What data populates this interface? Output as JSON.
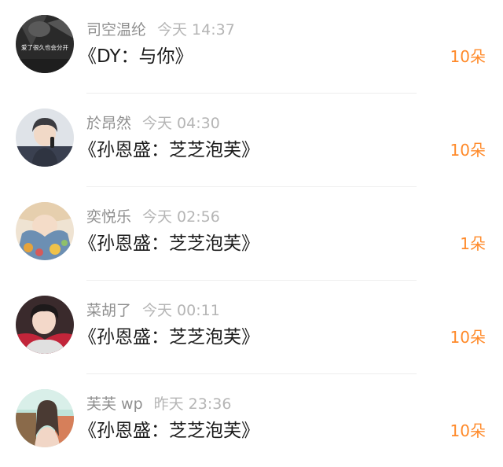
{
  "colors": {
    "username": "#8f8f8f",
    "time": "#b5b5b5",
    "song": "#1c1c1c",
    "accent": "#ff8a2a",
    "divider": "#eeeeee"
  },
  "items": [
    {
      "username": "司空温纶",
      "time": "今天 14:37",
      "song": "《DY：与你》",
      "count": "10朵",
      "avatar": {
        "icon": "avatar-dark-photo-icon",
        "caption": "爱了很久也会分开"
      }
    },
    {
      "username": "於昂然",
      "time": "今天 04:30",
      "song": "《孙恩盛：芝芝泡芙》",
      "count": "10朵",
      "avatar": {
        "icon": "avatar-portrait-icon"
      }
    },
    {
      "username": "奕悦乐",
      "time": "今天 02:56",
      "song": "《孙恩盛：芝芝泡芙》",
      "count": "1朵",
      "avatar": {
        "icon": "avatar-illustration-icon"
      }
    },
    {
      "username": "菜胡了",
      "time": "今天 00:11",
      "song": "《孙恩盛：芝芝泡芙》",
      "count": "10朵",
      "avatar": {
        "icon": "avatar-portrait-icon"
      }
    },
    {
      "username": "芙芙 wp",
      "time": "昨天 23:36",
      "song": "《孙恩盛：芝芝泡芙》",
      "count": "10朵",
      "avatar": {
        "icon": "avatar-portrait-icon"
      }
    }
  ]
}
